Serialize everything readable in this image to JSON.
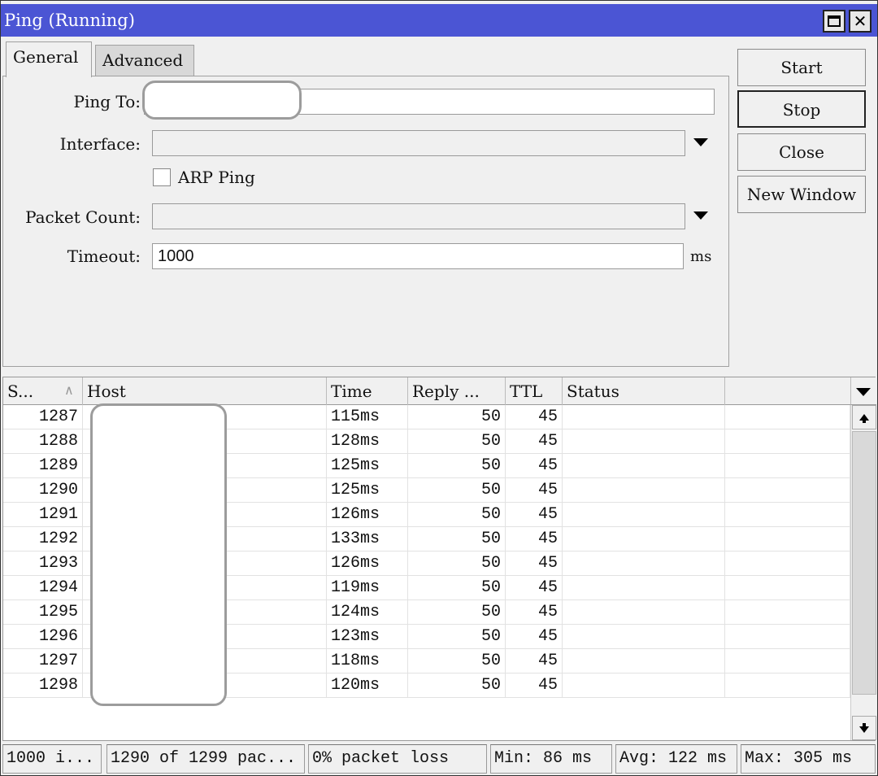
{
  "window": {
    "title": "Ping (Running)"
  },
  "tabs": [
    {
      "label": "General",
      "active": true
    },
    {
      "label": "Advanced",
      "active": false
    }
  ],
  "form": {
    "ping_to_label": "Ping To:",
    "ping_to_value": "",
    "interface_label": "Interface:",
    "interface_value": "",
    "arp_ping_label": "ARP Ping",
    "arp_ping_checked": false,
    "packet_count_label": "Packet Count:",
    "packet_count_value": "",
    "timeout_label": "Timeout:",
    "timeout_value": "1000",
    "timeout_unit": "ms"
  },
  "buttons": {
    "start": "Start",
    "stop": "Stop",
    "close": "Close",
    "new_window": "New Window"
  },
  "table": {
    "columns": [
      "S...",
      "Host",
      "Time",
      "Reply ...",
      "TTL",
      "Status"
    ],
    "rows": [
      {
        "seq": "1287",
        "host": "",
        "time": "115ms",
        "reply": "50",
        "ttl": "45",
        "status": ""
      },
      {
        "seq": "1288",
        "host": "",
        "time": "128ms",
        "reply": "50",
        "ttl": "45",
        "status": ""
      },
      {
        "seq": "1289",
        "host": "",
        "time": "125ms",
        "reply": "50",
        "ttl": "45",
        "status": ""
      },
      {
        "seq": "1290",
        "host": "",
        "time": "125ms",
        "reply": "50",
        "ttl": "45",
        "status": ""
      },
      {
        "seq": "1291",
        "host": "",
        "time": "126ms",
        "reply": "50",
        "ttl": "45",
        "status": ""
      },
      {
        "seq": "1292",
        "host": "",
        "time": "133ms",
        "reply": "50",
        "ttl": "45",
        "status": ""
      },
      {
        "seq": "1293",
        "host": "",
        "time": "126ms",
        "reply": "50",
        "ttl": "45",
        "status": ""
      },
      {
        "seq": "1294",
        "host": "",
        "time": "119ms",
        "reply": "50",
        "ttl": "45",
        "status": ""
      },
      {
        "seq": "1295",
        "host": "",
        "time": "124ms",
        "reply": "50",
        "ttl": "45",
        "status": ""
      },
      {
        "seq": "1296",
        "host": "",
        "time": "123ms",
        "reply": "50",
        "ttl": "45",
        "status": ""
      },
      {
        "seq": "1297",
        "host": "",
        "time": "118ms",
        "reply": "50",
        "ttl": "45",
        "status": ""
      },
      {
        "seq": "1298",
        "host": "",
        "time": "120ms",
        "reply": "50",
        "ttl": "45",
        "status": ""
      }
    ]
  },
  "status": {
    "interval": "1000 i...",
    "packets": "1290 of 1299 pac...",
    "loss": "0% packet loss",
    "min": "Min: 86 ms",
    "avg": "Avg: 122 ms",
    "max": "Max: 305 ms"
  },
  "icons": {
    "maximize": "maximize-icon",
    "close": "close-icon",
    "dropdown": "chevron-down-icon",
    "scroll_up": "scroll-up-icon",
    "scroll_down": "scroll-down-icon",
    "sort": "sort-ascending-icon"
  },
  "colors": {
    "titlebar": "#4b55d4",
    "window_bg": "#f0f0f0"
  }
}
